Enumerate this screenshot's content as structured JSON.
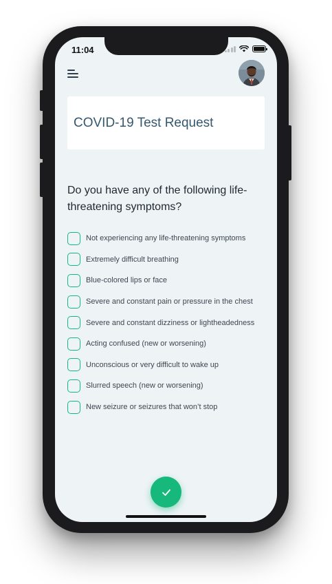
{
  "status_bar": {
    "time": "11:04",
    "icons": [
      "signal-icon",
      "wifi-icon",
      "battery-icon"
    ]
  },
  "header": {
    "menu_icon": "menu-icon",
    "avatar": "user-avatar"
  },
  "title_card": {
    "title": "COVID-19 Test Request"
  },
  "question": {
    "text": "Do you have any of the following life-threatening symptoms?"
  },
  "options": [
    {
      "label": "Not experiencing any life-threatening symptoms",
      "checked": false
    },
    {
      "label": "Extremely difficult breathing",
      "checked": false
    },
    {
      "label": "Blue-colored lips or face",
      "checked": false
    },
    {
      "label": "Severe and constant pain or pressure in the chest",
      "checked": false
    },
    {
      "label": "Severe and constant dizziness or lightheadedness",
      "checked": false
    },
    {
      "label": "Acting confused (new or worsening)",
      "checked": false
    },
    {
      "label": "Unconscious or very difficult to wake up",
      "checked": false
    },
    {
      "label": "Slurred speech (new or worsening)",
      "checked": false
    },
    {
      "label": "New seizure or seizures that won’t stop",
      "checked": false
    }
  ],
  "submit": {
    "icon": "check-icon"
  },
  "colors": {
    "accent": "#16b87c",
    "title_text": "#33586f",
    "screen_bg": "#eef3f6"
  }
}
